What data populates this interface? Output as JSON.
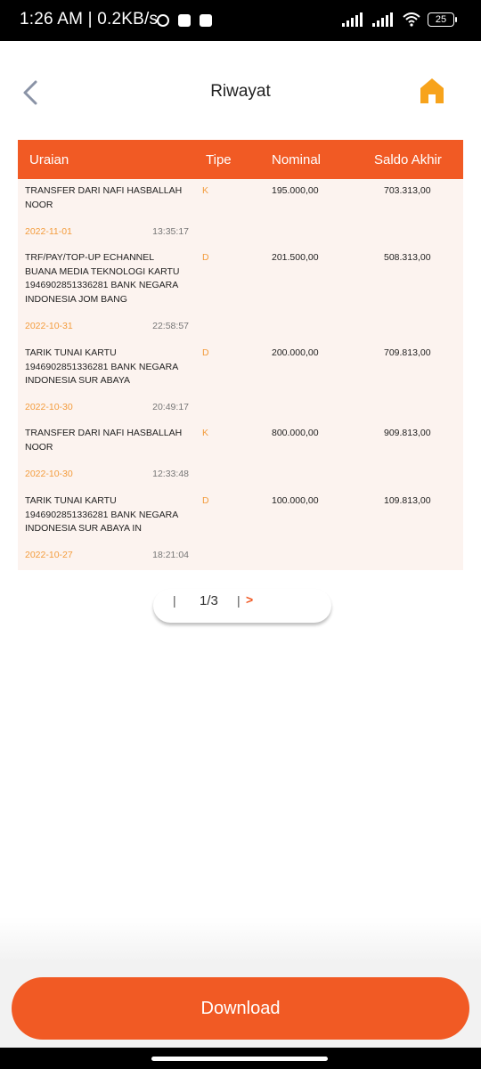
{
  "status_bar": {
    "time_text": "1:26 AM | 0.2KB/s",
    "battery": "25",
    "icons": [
      "alarm-icon",
      "app-icon",
      "app-icon",
      "signal-icon",
      "signal-icon",
      "wifi-icon",
      "battery-icon"
    ]
  },
  "header": {
    "title": "Riwayat",
    "back_icon": "chevron-left-icon",
    "home_icon": "home-icon"
  },
  "colors": {
    "accent": "#f15a24",
    "accent_text": "#f39c3d",
    "table_bg": "#fcf3ef",
    "home_icon": "#f7a31c"
  },
  "table": {
    "headers": {
      "uraian": "Uraian",
      "tipe": "Tipe",
      "nominal": "Nominal",
      "saldo": "Saldo Akhir"
    },
    "rows": [
      {
        "lines": [
          "TRANSFER DARI NAFI HASBALLAH",
          "NOOR"
        ],
        "type": "K",
        "nominal": "195.000,00",
        "saldo": "703.313,00",
        "date": "2022-11-01",
        "time": "13:35:17"
      },
      {
        "lines": [
          "TRF/PAY/TOP-UP ECHANNEL",
          "BUANA MEDIA TEKNOLOGI KARTU",
          "1946902851336281 BANK NEGARA",
          "INDONESIA JOM BANG"
        ],
        "type": "D",
        "nominal": "201.500,00",
        "saldo": "508.313,00",
        "date": "2022-10-31",
        "time": "22:58:57"
      },
      {
        "lines": [
          "TARIK TUNAI KARTU",
          "1946902851336281 BANK NEGARA",
          "INDONESIA SUR ABAYA"
        ],
        "type": "D",
        "nominal": "200.000,00",
        "saldo": "709.813,00",
        "date": "2022-10-30",
        "time": "20:49:17"
      },
      {
        "lines": [
          "TRANSFER DARI NAFI HASBALLAH",
          "NOOR"
        ],
        "type": "K",
        "nominal": "800.000,00",
        "saldo": "909.813,00",
        "date": "2022-10-30",
        "time": "12:33:48"
      },
      {
        "lines": [
          "TARIK TUNAI KARTU",
          "1946902851336281 BANK NEGARA",
          "INDONESIA SUR ABAYA IN"
        ],
        "type": "D",
        "nominal": "100.000,00",
        "saldo": "109.813,00",
        "date": "2022-10-27",
        "time": "18:21:04"
      }
    ]
  },
  "pagination": {
    "separator": "|",
    "page": "1/3",
    "separator2": "|",
    "next": ">"
  },
  "download": {
    "label": "Download"
  }
}
